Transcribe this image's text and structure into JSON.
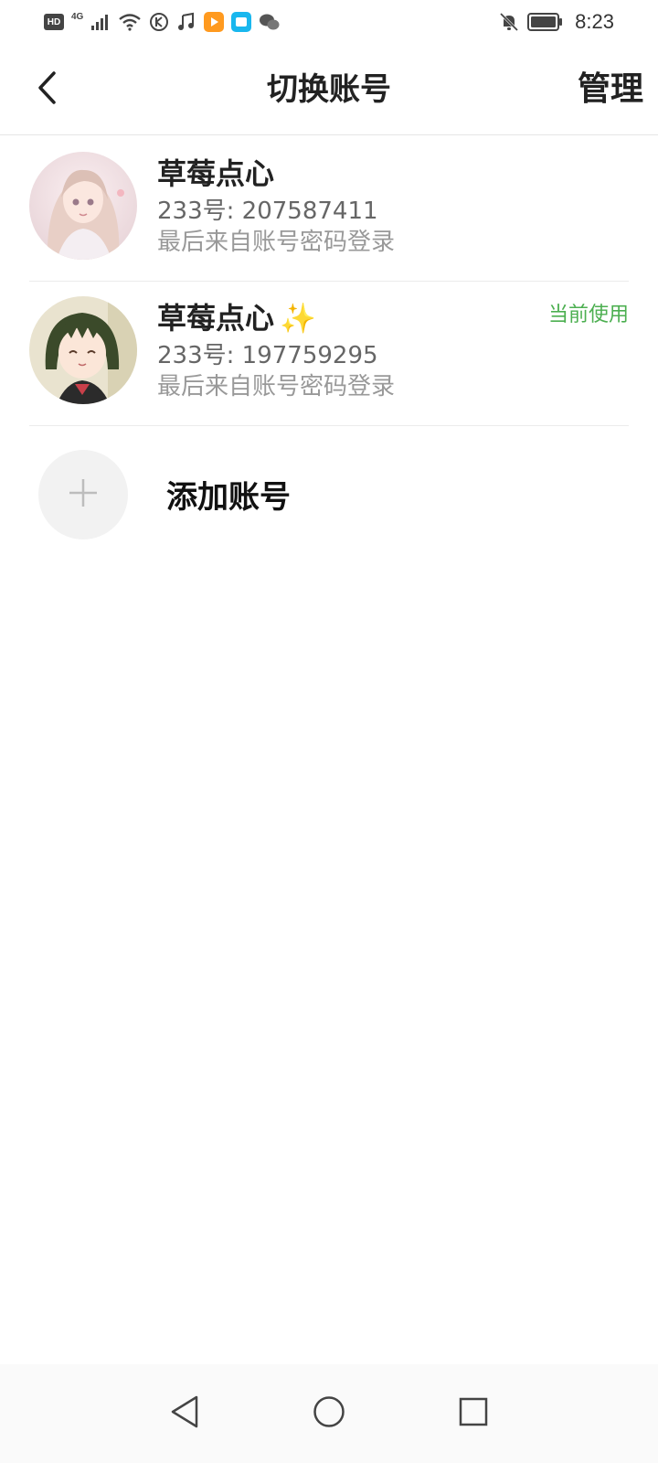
{
  "status_bar": {
    "network_badge": "HD",
    "network_type": "4G",
    "time": "8:23",
    "icons": [
      "signal-icon",
      "wifi-icon",
      "kugou-app-icon",
      "music-note-icon",
      "video-app-icon",
      "tv-app-icon",
      "wechat-icon",
      "bell-muted-icon",
      "battery-icon"
    ]
  },
  "header": {
    "title": "切换账号",
    "manage_label": "管理",
    "back_icon": "chevron-left-icon"
  },
  "accounts": [
    {
      "name": "草莓点心",
      "id_line": "233号: 207587411",
      "login_line": "最后来自账号密码登录",
      "current_label": "",
      "avatar": "anime-girl-light-hair-avatar"
    },
    {
      "name": "草莓点心",
      "name_emoji": "✨",
      "id_line": "233号: 197759295",
      "login_line": "最后来自账号密码登录",
      "current_label": "当前使用",
      "avatar": "anime-girl-dark-hair-avatar"
    }
  ],
  "add_account": {
    "label": "添加账号",
    "icon": "plus-icon"
  },
  "nav": {
    "icons": [
      "back-triangle-icon",
      "home-circle-icon",
      "recents-square-icon"
    ]
  },
  "colors": {
    "current_badge": "#4caf50",
    "name_text": "#222222",
    "secondary_text": "#666666",
    "tertiary_text": "#999999"
  }
}
